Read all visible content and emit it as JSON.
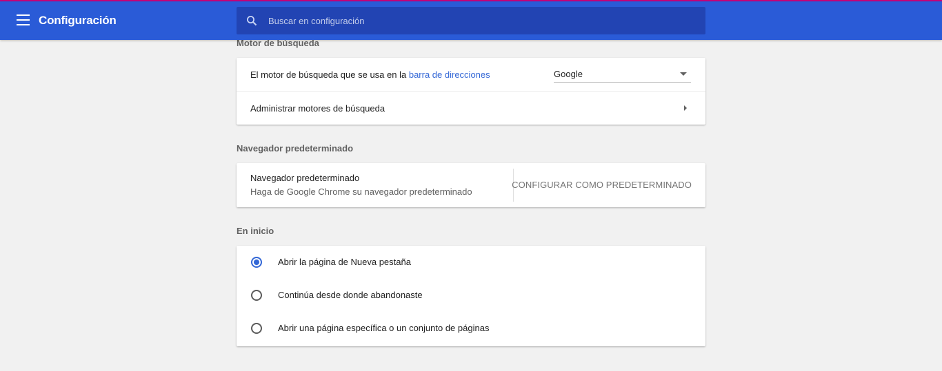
{
  "header": {
    "title": "Configuración",
    "search_placeholder": "Buscar en configuración"
  },
  "search_engine": {
    "section_title": "Motor de búsqueda",
    "engine_row": {
      "label": "El motor de búsqueda que se usa en la",
      "link": "barra de direcciones",
      "selected": "Google"
    },
    "manage_label": "Administrar motores de búsqueda"
  },
  "default_browser": {
    "section_title": "Navegador predeterminado",
    "label": "Navegador predeterminado",
    "sublabel": "Haga de Google Chrome su navegador predeterminado",
    "button": "CONFIGURAR COMO PREDETERMINADO"
  },
  "on_startup": {
    "section_title": "En inicio",
    "options": [
      {
        "label": "Abrir la página de Nueva pestaña",
        "checked": true
      },
      {
        "label": "Continúa desde donde abandonaste",
        "checked": false
      },
      {
        "label": "Abrir una página específica o un conjunto de páginas",
        "checked": false
      }
    ]
  },
  "colors": {
    "toolbar": "#2a5bd7",
    "accent": "#3367d6",
    "background": "#f1f1f1"
  }
}
